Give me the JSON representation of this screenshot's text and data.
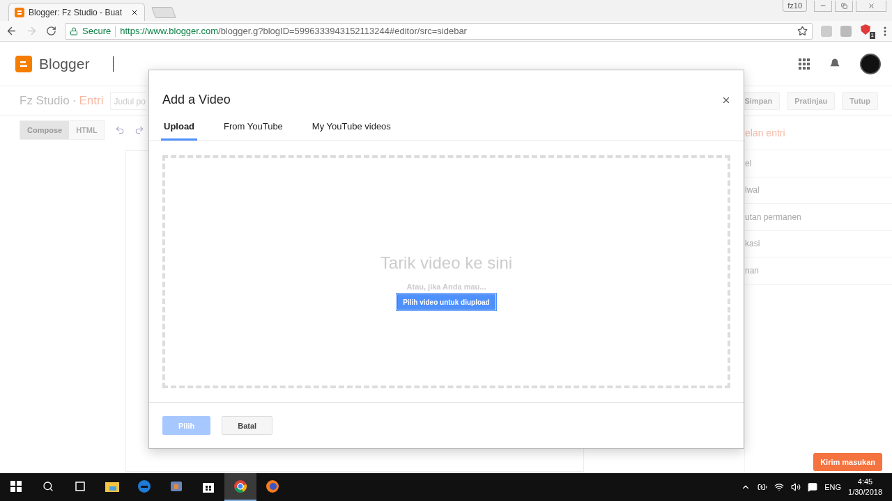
{
  "browser": {
    "tab": {
      "title": "Blogger: Fz Studio - Buat"
    },
    "profile": "fz10",
    "address": {
      "security": "Secure",
      "url_host": "https://www.blogger.com",
      "url_path": "/blogger.g?blogID=5996333943152113244#editor/src=sidebar"
    },
    "extension_badge": "1"
  },
  "app": {
    "name": "Blogger"
  },
  "editor": {
    "blog": "Fz Studio",
    "separator": "·",
    "section": "Entri",
    "title_placeholder": "Judul po",
    "modes": [
      {
        "label": "Compose",
        "selected": true
      },
      {
        "label": "HTML",
        "selected": false
      }
    ],
    "actions": [
      "Simpan",
      "Pratinjau",
      "Tutup"
    ],
    "sidebar": {
      "heading": "elan entri",
      "items": [
        "el",
        "lwal",
        "utan permanen",
        "kasi",
        "nan"
      ]
    }
  },
  "dialog": {
    "title": "Add a Video",
    "tabs": [
      {
        "label": "Upload",
        "selected": true
      },
      {
        "label": "From YouTube",
        "selected": false
      },
      {
        "label": "My YouTube videos",
        "selected": false
      }
    ],
    "dropzone": {
      "heading": "Tarik video ke sini",
      "alt": "Atau, jika Anda mau...",
      "button": "Pilih video untuk diupload"
    },
    "buttons": [
      {
        "label": "Pilih",
        "disabled": true
      },
      {
        "label": "Batal",
        "disabled": false
      }
    ]
  },
  "feedback": "Kirim masukan",
  "taskbar": {
    "apps": [
      {
        "kind": "explorer",
        "selected": false
      },
      {
        "kind": "edge",
        "selected": false
      },
      {
        "kind": "media",
        "selected": false
      },
      {
        "kind": "store",
        "selected": false
      },
      {
        "kind": "chrome",
        "selected": true
      },
      {
        "kind": "firefox",
        "selected": false
      }
    ],
    "language": "ENG",
    "time": "4:45",
    "date": "1/30/2018"
  }
}
